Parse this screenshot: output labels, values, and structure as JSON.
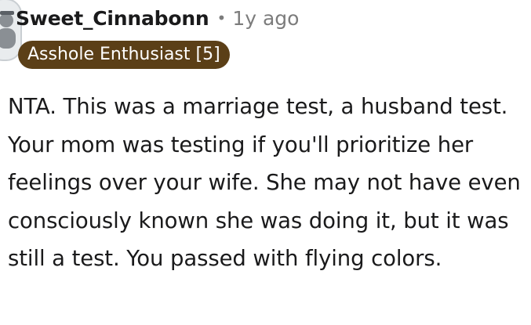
{
  "comment": {
    "author": "Sweet_Cinnabonn",
    "separator": "•",
    "timestamp": "1y ago",
    "flair": "Asshole Enthusiast [5]",
    "body": "NTA. This was a marriage test, a husband test. Your mom was testing if you'll prioritize her feelings over your wife. She may not have even consciously known she was doing it, but it was still a test. You passed with flying colors."
  },
  "icons": {
    "avatar": "user-avatar-icon"
  },
  "colors": {
    "flair_background": "#5b3f17",
    "flair_text": "#ffffff",
    "username": "#1a1a1b",
    "meta": "#7c7c7c",
    "body_text": "#1a1a1b"
  }
}
